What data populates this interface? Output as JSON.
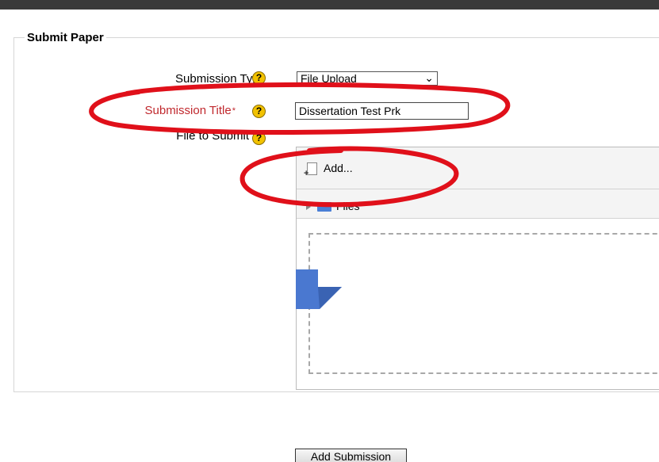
{
  "form": {
    "legend": "Submit Paper",
    "submission_type": {
      "label": "Submission Type",
      "selected": "File Upload"
    },
    "submission_title": {
      "label": "Submission Title",
      "required_marker": "*",
      "value": "Dissertation Test Prk"
    },
    "file_to_submit": {
      "label": "File to Submit"
    },
    "help_glyph": "?"
  },
  "uploader": {
    "add_label": "Add...",
    "files_label": "Files"
  },
  "actions": {
    "submit_label": "Add Submission"
  },
  "colors": {
    "required_label": "#c0282d",
    "help_icon": "#f2c200",
    "annotation_ellipse": "#e0101a",
    "drop_arrow": "#4a78d0"
  },
  "icons": {
    "help": "question-circle-icon",
    "add_file": "file-add-icon",
    "expand": "triangle-right-icon",
    "folder": "folder-icon",
    "dropdown": "chevron-down-icon",
    "drop_target": "arrow-down-icon"
  }
}
